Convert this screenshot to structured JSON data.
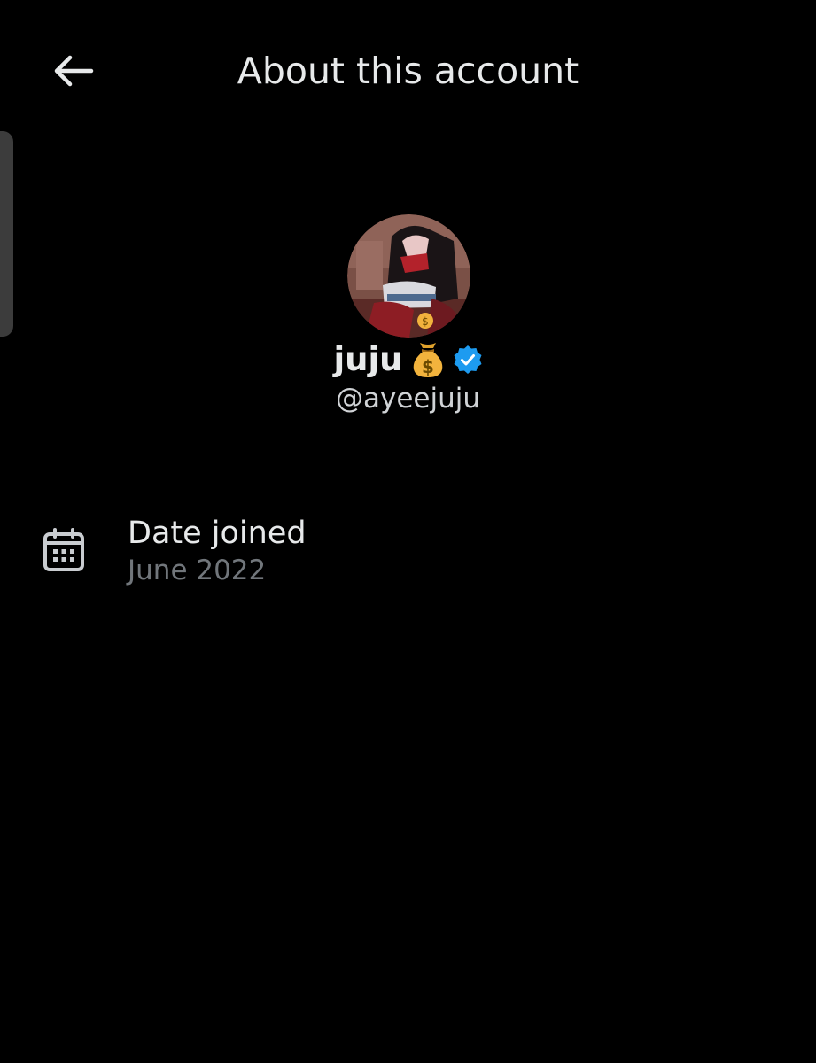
{
  "header": {
    "title": "About this account",
    "back_icon": "arrow-left-icon"
  },
  "profile": {
    "display_name": "juju",
    "name_emoji": "💰",
    "avatar_badge_emoji": "💲",
    "verified_icon": "verified-badge-icon",
    "verified_color": "#1d9bf0",
    "handle": "@ayeejuju"
  },
  "details": [
    {
      "icon": "calendar-icon",
      "label": "Date joined",
      "value": "June 2022"
    }
  ],
  "colors": {
    "background": "#000000",
    "primary_text": "#e7e9ea",
    "secondary_text": "#71767b"
  }
}
